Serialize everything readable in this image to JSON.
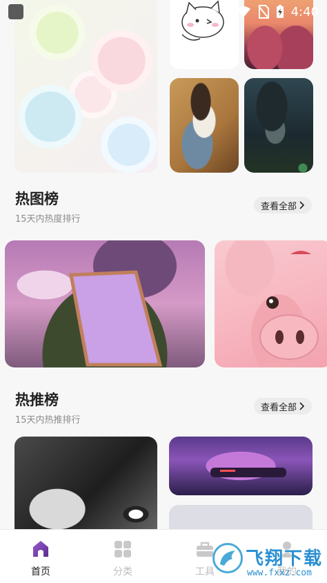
{
  "status_bar": {
    "time": "4:40"
  },
  "sections": {
    "hot_images": {
      "title": "热图榜",
      "subtitle": "15天内热度排行",
      "see_all": "查看全部"
    },
    "hot_recommend": {
      "title": "热推榜",
      "subtitle": "15天内热推排行",
      "see_all": "查看全部"
    }
  },
  "bottom_nav": {
    "items": [
      {
        "label": "首页",
        "active": true
      },
      {
        "label": "分类",
        "active": false
      },
      {
        "label": "工具",
        "active": false
      },
      {
        "label": "我的",
        "active": false
      }
    ]
  },
  "watermark": {
    "text": "飞翔下载",
    "url": "www.fxxz.com"
  },
  "colors": {
    "active": "#6b3fa6",
    "inactive": "#bdbdbd"
  }
}
